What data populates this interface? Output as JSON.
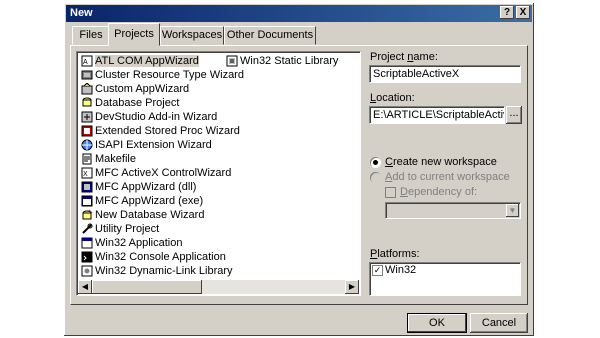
{
  "window": {
    "title": "New"
  },
  "titlebar_buttons": {
    "help": "?",
    "close": "X"
  },
  "tabs": [
    {
      "label": "Files"
    },
    {
      "label": "Projects"
    },
    {
      "label": "Workspaces"
    },
    {
      "label": "Other Documents"
    }
  ],
  "projects": [
    {
      "label": "ATL COM AppWizard",
      "icon": "atl-icon"
    },
    {
      "label": "Cluster Resource Type Wizard",
      "icon": "cluster-icon"
    },
    {
      "label": "Custom AppWizard",
      "icon": "custom-wizard-icon"
    },
    {
      "label": "Database Project",
      "icon": "database-icon"
    },
    {
      "label": "DevStudio Add-in Wizard",
      "icon": "addin-icon"
    },
    {
      "label": "Extended Stored Proc Wizard",
      "icon": "stored-proc-icon"
    },
    {
      "label": "ISAPI Extension Wizard",
      "icon": "isapi-icon"
    },
    {
      "label": "Makefile",
      "icon": "makefile-icon"
    },
    {
      "label": "MFC ActiveX ControlWizard",
      "icon": "activex-icon"
    },
    {
      "label": "MFC AppWizard (dll)",
      "icon": "mfc-dll-icon"
    },
    {
      "label": "MFC AppWizard (exe)",
      "icon": "mfc-exe-icon"
    },
    {
      "label": "New Database Wizard",
      "icon": "new-db-icon"
    },
    {
      "label": "Utility Project",
      "icon": "utility-icon"
    },
    {
      "label": "Win32 Application",
      "icon": "win32-app-icon"
    },
    {
      "label": "Win32 Console Application",
      "icon": "console-icon"
    },
    {
      "label": "Win32 Dynamic-Link Library",
      "icon": "dll-icon"
    },
    {
      "label": "Win32 Static Library",
      "icon": "static-lib-icon"
    }
  ],
  "project_name": {
    "label_pre": "Project ",
    "label_u": "n",
    "label_post": "ame:",
    "value": "ScriptableActiveX"
  },
  "location": {
    "label_pre": "",
    "label_u": "L",
    "label_post": "ocation:",
    "value": "E:\\ARTICLE\\ScriptableActiveX",
    "browse": "..."
  },
  "workspace": {
    "create_pre": "",
    "create_u": "C",
    "create_post": "reate new workspace",
    "add_pre": "",
    "add_u": "A",
    "add_post": "dd to current workspace",
    "dep_pre": "",
    "dep_u": "D",
    "dep_post": "ependency of:"
  },
  "platforms": {
    "label_pre": "",
    "label_u": "P",
    "label_post": "latforms:",
    "items": [
      "Win32"
    ]
  },
  "buttons": {
    "ok": "OK",
    "cancel": "Cancel"
  }
}
